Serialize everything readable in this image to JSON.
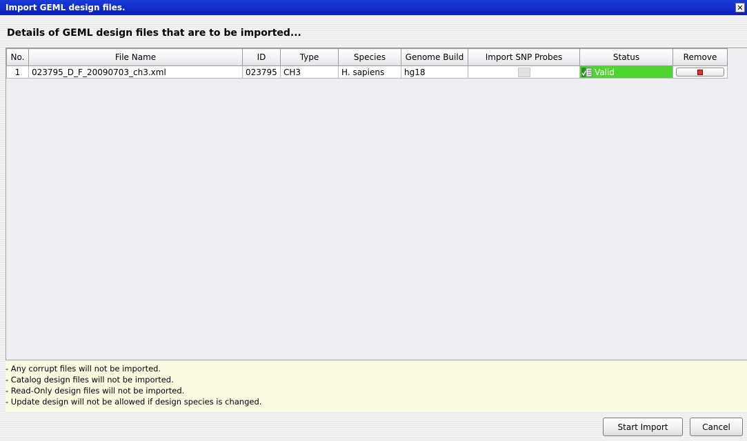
{
  "window": {
    "title": "Import GEML design files.",
    "close_label": "✕"
  },
  "heading": "Details of GEML design files that are to be imported...",
  "table": {
    "columns": [
      "No.",
      "File Name",
      "ID",
      "Type",
      "Species",
      "Genome Build",
      "Import SNP Probes",
      "Status",
      "Remove"
    ],
    "rows": [
      {
        "no": "1",
        "file_name": "023795_D_F_20090703_ch3.xml",
        "id": "023795",
        "type": "CH3",
        "species": "H. sapiens",
        "genome_build": "hg18",
        "import_snp_probes": false,
        "status": "Valid",
        "status_color": "#4ed52f"
      }
    ]
  },
  "notes": [
    "- Any corrupt files will not be imported.",
    "- Catalog design files will not be imported.",
    "- Read-Only design files will not be imported.",
    "- Update design will not be allowed if design species is changed."
  ],
  "buttons": {
    "start_import": "Start Import",
    "cancel": "Cancel"
  },
  "colors": {
    "titlebar": "#0a24c8",
    "notes_bg": "#fbfbe2",
    "valid": "#4ed52f"
  }
}
